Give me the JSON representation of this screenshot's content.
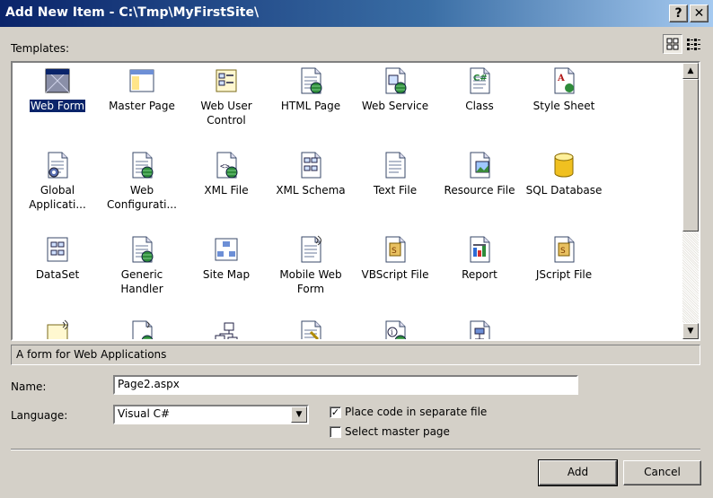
{
  "window": {
    "title": "Add New Item - C:\\Tmp\\MyFirstSite\\",
    "help": "?",
    "close": "✕"
  },
  "templates_label": "Templates:",
  "templates": [
    {
      "label": "Web Form",
      "icon": "web-form-icon",
      "selected": true
    },
    {
      "label": "Master Page",
      "icon": "master-page-icon"
    },
    {
      "label": "Web User Control",
      "icon": "web-user-control-icon"
    },
    {
      "label": "HTML Page",
      "icon": "html-page-icon"
    },
    {
      "label": "Web Service",
      "icon": "web-service-icon"
    },
    {
      "label": "Class",
      "icon": "class-icon"
    },
    {
      "label": "Style Sheet",
      "icon": "style-sheet-icon"
    },
    {
      "label": "Global Applicati...",
      "icon": "global-application-icon"
    },
    {
      "label": "Web Configurati...",
      "icon": "web-configuration-icon"
    },
    {
      "label": "XML File",
      "icon": "xml-file-icon"
    },
    {
      "label": "XML Schema",
      "icon": "xml-schema-icon"
    },
    {
      "label": "Text File",
      "icon": "text-file-icon"
    },
    {
      "label": "Resource File",
      "icon": "resource-file-icon"
    },
    {
      "label": "SQL Database",
      "icon": "sql-database-icon"
    },
    {
      "label": "DataSet",
      "icon": "dataset-icon"
    },
    {
      "label": "Generic Handler",
      "icon": "generic-handler-icon"
    },
    {
      "label": "Site Map",
      "icon": "site-map-icon"
    },
    {
      "label": "Mobile Web Form",
      "icon": "mobile-web-form-icon"
    },
    {
      "label": "VBScript File",
      "icon": "vbscript-file-icon"
    },
    {
      "label": "Report",
      "icon": "report-icon"
    },
    {
      "label": "JScript File",
      "icon": "jscript-file-icon"
    },
    {
      "label": "",
      "icon": "mobile-web-user-control-icon"
    },
    {
      "label": "",
      "icon": "mobile-web-configuration-icon"
    },
    {
      "label": "",
      "icon": "class-diagram-icon"
    },
    {
      "label": "",
      "icon": "skin-file-icon"
    },
    {
      "label": "",
      "icon": "browser-file-icon"
    },
    {
      "label": "",
      "icon": "xslt-file-icon"
    }
  ],
  "description": "A form for Web Applications",
  "name": {
    "label": "Name:",
    "value": "Page2.aspx"
  },
  "language": {
    "label": "Language:",
    "selected": "Visual C#"
  },
  "options": {
    "separate_file": {
      "label": "Place code in separate file",
      "checked": true
    },
    "master_page": {
      "label": "Select master page",
      "checked": false
    }
  },
  "buttons": {
    "add": "Add",
    "cancel": "Cancel"
  },
  "colors": {
    "title_start": "#0a246a",
    "title_end": "#a6caf0",
    "face": "#d4d0c8",
    "selection": "#0a246a"
  }
}
